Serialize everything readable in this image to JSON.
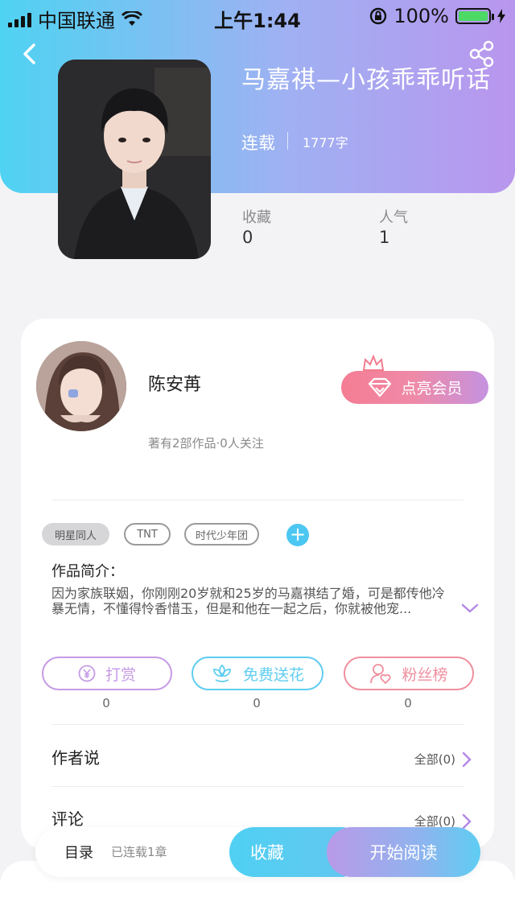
{
  "status_bar": {
    "carrier": "中国联通",
    "time": "上午1:44",
    "battery": "100%"
  },
  "book": {
    "title": "马嘉祺—小孩乖乖听话",
    "status": "连载",
    "word_count": "1777字"
  },
  "stats": [
    {
      "label": "收藏",
      "value": "0"
    },
    {
      "label": "人气",
      "value": "1"
    }
  ],
  "author": {
    "name": "陈安苒",
    "meta": "著有2部作品·0人关注",
    "vip_label": "点亮会员"
  },
  "tags": [
    "明星同人",
    "TNT",
    "时代少年团"
  ],
  "intro": {
    "heading": "作品简介：",
    "text": "因为家族联姻，你刚刚20岁就和25岁的马嘉祺结了婚，可是都传他冷暴无情，不懂得怜香惜玉，但是和他在一起之后，你就被他宠..."
  },
  "actions": [
    {
      "label": "打赏",
      "count": "0",
      "color": "#c69be6"
    },
    {
      "label": "免费送花",
      "count": "0",
      "color": "#5fcdf0"
    },
    {
      "label": "粉丝榜",
      "count": "0",
      "color": "#ef8f9e"
    }
  ],
  "rows": [
    {
      "label": "作者说",
      "right": "全部(0)"
    },
    {
      "label": "评论",
      "right": "全部(0)"
    }
  ],
  "bottom_bar": {
    "toc": "目录",
    "chapters": "已连载1章",
    "collect": "收藏",
    "read": "开始阅读"
  },
  "colors": {
    "header_gradient_start": "#4fd3f2",
    "header_gradient_end": "#b996ee",
    "accent_blue": "#4cc7f2",
    "accent_purple": "#b58ae6"
  }
}
